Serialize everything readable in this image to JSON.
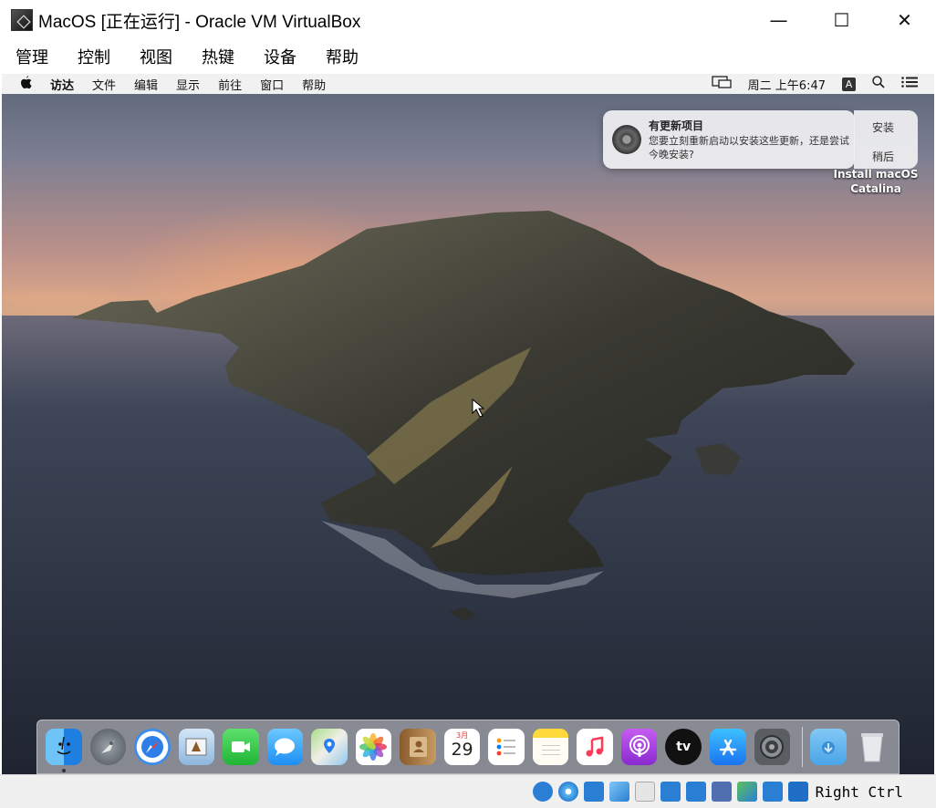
{
  "window": {
    "title": "MacOS [正在运行] - Oracle VM VirtualBox",
    "minimize": "—",
    "maximize": "☐",
    "close": "✕"
  },
  "vb_menu": [
    "管理",
    "控制",
    "视图",
    "热键",
    "设备",
    "帮助"
  ],
  "mac_menubar": {
    "apple": "",
    "items": [
      "访达",
      "文件",
      "编辑",
      "显示",
      "前往",
      "窗口",
      "帮助"
    ],
    "clock": "周二 上午6:47",
    "input_badge": "A",
    "search": "⌕",
    "list": "☰"
  },
  "notification": {
    "title": "有更新项目",
    "body": "您要立刻重新启动以安装这些更新，还是尝试今晚安装?",
    "action_install": "安装",
    "action_later": "稍后"
  },
  "desktop_icon": {
    "label_line1": "Install macOS",
    "label_line2": "Catalina"
  },
  "dock": {
    "calendar_month": "3月",
    "calendar_day": "29",
    "tv_label": "tv"
  },
  "statusbar": {
    "host_key": "Right Ctrl"
  },
  "colors": {
    "titlebar_bg": "#ffffff",
    "statusbar_bg": "#f0f0f0",
    "mac_menubar_bg": "#f6f6f6"
  }
}
